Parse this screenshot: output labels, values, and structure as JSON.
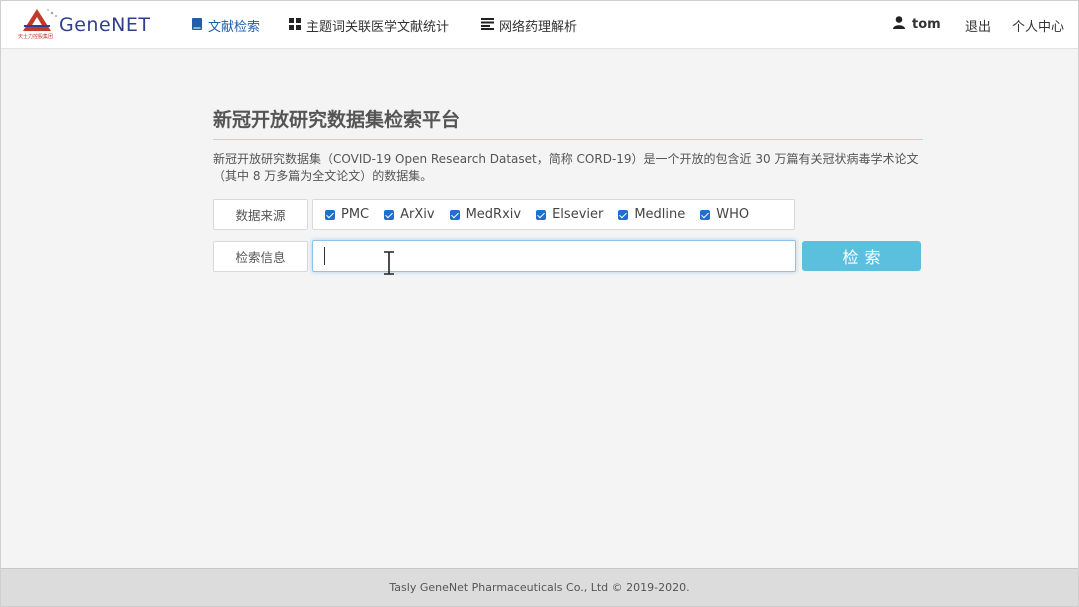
{
  "brand": {
    "name": "GeneNET",
    "subtitle": "天士力控股集团"
  },
  "nav": {
    "items": [
      {
        "label": "文献检索",
        "icon": "book-icon"
      },
      {
        "label": "主题词关联医学文献统计",
        "icon": "grid-icon"
      },
      {
        "label": "网络药理解析",
        "icon": "list-icon"
      }
    ],
    "user": {
      "name": "tom",
      "icon": "user-icon"
    },
    "logout": "退出",
    "profile": "个人中心"
  },
  "main": {
    "title": "新冠开放研究数据集检索平台",
    "description": "新冠开放研究数据集（COVID-19 Open Research Dataset，简称 CORD-19）是一个开放的包含近 30 万篇有关冠状病毒学术论文（其中 8 万多篇为全文论文）的数据集。",
    "source_label": "数据来源",
    "sources": [
      {
        "label": "PMC",
        "checked": true
      },
      {
        "label": "ArXiv",
        "checked": true
      },
      {
        "label": "MedRxiv",
        "checked": true
      },
      {
        "label": "Elsevier",
        "checked": true
      },
      {
        "label": "Medline",
        "checked": true
      },
      {
        "label": "WHO",
        "checked": true
      }
    ],
    "query_label": "检索信息",
    "query_value": "",
    "search_button": "检索"
  },
  "footer": {
    "text": "Tasly GeneNet Pharmaceuticals Co., Ltd © 2019-2020."
  },
  "colors": {
    "accent": "#1f5fa8",
    "button": "#5bc0de",
    "checkbox": "#1f6fd1"
  }
}
